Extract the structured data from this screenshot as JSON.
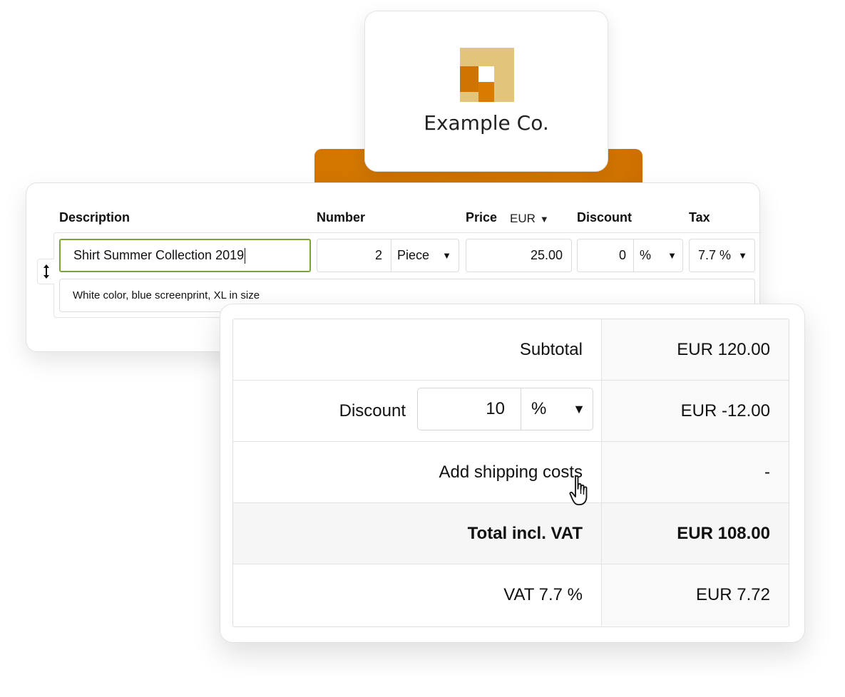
{
  "brand": {
    "name": "Example Co.",
    "colors": {
      "dark": "#d97b00",
      "light": "#e2c57a",
      "accent": "#cf7400"
    }
  },
  "items": {
    "columns": {
      "description": "Description",
      "number": "Number",
      "price": "Price",
      "currency": "EUR",
      "discount": "Discount",
      "tax": "Tax"
    },
    "row": {
      "description": "Shirt Summer Collection 2019",
      "quantity": "2",
      "unit": "Piece",
      "price": "25.00",
      "discount_value": "0",
      "discount_unit": "%",
      "tax": "7.7 %",
      "note": "White color, blue screenprint, XL in size"
    }
  },
  "totals": {
    "subtotal_label": "Subtotal",
    "subtotal_amount": "EUR 120.00",
    "discount_label": "Discount",
    "discount_value": "10",
    "discount_unit": "%",
    "discount_amount": "EUR -12.00",
    "shipping_label": "Add shipping costs",
    "shipping_amount": "-",
    "total_label": "Total incl. VAT",
    "total_amount": "EUR 108.00",
    "vat_label": "VAT 7.7 %",
    "vat_amount": "EUR 7.72"
  },
  "icons": {
    "dropdown": "caret-down-icon",
    "drag": "vertical-resize-icon",
    "cursor": "hand-pointer-icon"
  }
}
